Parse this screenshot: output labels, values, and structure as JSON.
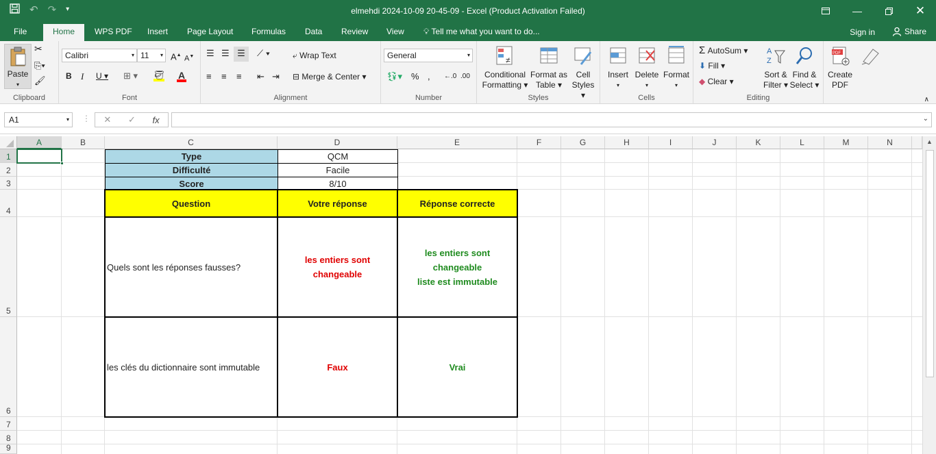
{
  "window": {
    "title": "elmehdi 2024-10-09 20-45-09 - Excel (Product Activation Failed)"
  },
  "tabs": [
    "File",
    "Home",
    "WPS PDF",
    "Insert",
    "Page Layout",
    "Formulas",
    "Data",
    "Review",
    "View"
  ],
  "tell_me": "Tell me what you want to do...",
  "account": {
    "sign_in": "Sign in",
    "share": "Share"
  },
  "ribbon": {
    "clipboard": {
      "label": "Clipboard",
      "paste": "Paste"
    },
    "font": {
      "label": "Font",
      "name": "Calibri",
      "size": "11"
    },
    "alignment": {
      "label": "Alignment",
      "wrap_text": "Wrap Text",
      "merge_center": "Merge & Center"
    },
    "number": {
      "label": "Number",
      "format": "General"
    },
    "styles": {
      "label": "Styles",
      "conditional": "Conditional",
      "formatting": "Formatting",
      "format_as": "Format as",
      "table": "Table",
      "cell": "Cell",
      "cell_styles": "Styles"
    },
    "cells": {
      "label": "Cells",
      "insert": "Insert",
      "delete": "Delete",
      "format": "Format"
    },
    "editing": {
      "label": "Editing",
      "autosum": "AutoSum",
      "fill": "Fill",
      "clear": "Clear",
      "sort": "Sort &",
      "filter": "Filter",
      "find": "Find &",
      "select": "Select"
    },
    "pdf": {
      "create": "Create",
      "pdf": "PDF"
    }
  },
  "formula_bar": {
    "name_box": "A1",
    "fx": "fx",
    "value": ""
  },
  "columns": [
    "A",
    "B",
    "C",
    "D",
    "E",
    "F",
    "G",
    "H",
    "I",
    "J",
    "K",
    "L",
    "M",
    "N"
  ],
  "rows": [
    "1",
    "2",
    "3",
    "4",
    "5",
    "6",
    "7",
    "8",
    "9"
  ],
  "sheet": {
    "c1": "Type",
    "d1": "QCM",
    "c2": "Difficulté",
    "d2": "Facile",
    "c3": "Score",
    "d3": "8/10",
    "c4": "Question",
    "d4": "Votre réponse",
    "e4": "Réponse correcte",
    "c5": "Quels sont les réponses fausses?",
    "d5_line1": "les entiers sont",
    "d5_line2": "changeable",
    "e5_line1": "les entiers sont",
    "e5_line2": "changeable",
    "e5_line3": "liste est immutable",
    "c6": "les clés du dictionnaire sont immutable",
    "d6": "Faux",
    "e6": "Vrai"
  }
}
